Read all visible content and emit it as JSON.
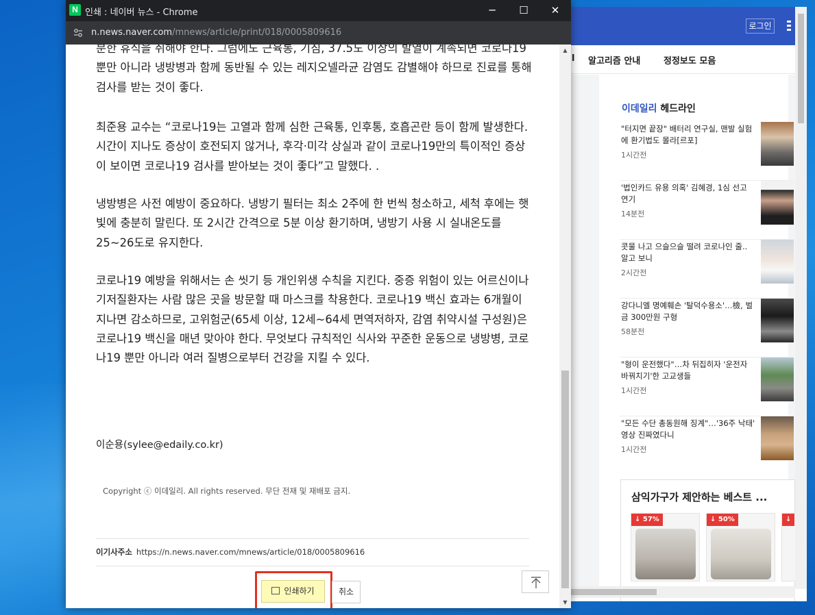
{
  "popup": {
    "app_icon_letter": "N",
    "window_title": "인쇄 : 네이버 뉴스 - Chrome",
    "url_domain": "n.news.naver.com",
    "url_path": "/mnews/article/print/018/0005809616",
    "controls": {
      "minimize": "─",
      "maximize": "☐",
      "close": "✕"
    }
  },
  "article": {
    "paragraphs": [
      "분한 휴식을 취해야 한다. 그럼에도 근육통, 기침, 37.5도 이상의 발열이 계속되면 코로나19 뿐만 아니라 냉방병과 함께 동반될 수 있는 레지오넬라균 감염도 감별해야 하므로 진료를 통해 검사를 받는 것이 좋다.",
      "최준용 교수는 “코로나19는 고열과 함께 심한 근육통, 인후통, 호흡곤란 등이 함께 발생한다. 시간이 지나도 증상이 호전되지 않거나, 후각·미각 상실과 같이 코로나19만의 특이적인 증상이 보이면 코로나19 검사를 받아보는 것이 좋다”고 말했다. .",
      "냉방병은 사전 예방이 중요하다. 냉방기 필터는 최소 2주에 한 번씩 청소하고, 세척 후에는 햇빛에 충분히 말린다. 또 2시간 간격으로 5분 이상 환기하며, 냉방기 사용 시 실내온도를 25~26도로 유지한다.",
      "코로나19 예방을 위해서는 손 씻기 등 개인위생 수칙을 지킨다. 중증 위험이 있는 어르신이나 기저질환자는 사람 많은 곳을 방문할 때 마스크를 착용한다. 코로나19 백신 효과는 6개월이 지나면 감소하므로, 고위험군(65세 이상, 12세~64세 면역저하자, 감염 취약시설 구성원)은 코로나19 백신을 매년 맞아야 한다. 무엇보다 규칙적인 식사와 꾸준한 운동으로 냉방병, 코로나19 뿐만 아니라 여러 질병으로부터 건강을 지킬 수 있다."
    ],
    "byline": "이순용(sylee@edaily.co.kr)",
    "copyright": "Copyright ⓒ 이데일리. All rights reserved. 무단 전재 및 재배포 금지.",
    "url_label": "이기사주소",
    "url_value": "https://n.news.naver.com/mnews/article/018/0005809616"
  },
  "actions": {
    "print_label": "인쇄하기",
    "cancel_label": "취소",
    "top_icon": "arrow-up-icon"
  },
  "background_page": {
    "login_label": "로그인",
    "nav_partial": "l",
    "nav_items": [
      "알고리즘 안내",
      "정정보도 모음"
    ],
    "headline_brand": "이데일리",
    "headline_suffix": " 헤드라인",
    "headlines": [
      {
        "title": "\"터지면 끝장\" 배터리 연구실, 맨발 실험에 환기법도 몰라[르포]",
        "time": "1시간전"
      },
      {
        "title": "'법인카드 유용 의혹' 김혜경, 1심 선고 연기",
        "time": "14분전"
      },
      {
        "title": "콧물 나고 으슬으슬 떨려 코로나인 줄.. 알고 보니",
        "time": "2시간전"
      },
      {
        "title": "강다니엘 명예훼손 '탈덕수용소'…檢, 벌금 300만원 구형",
        "time": "58분전"
      },
      {
        "title": "\"형이 운전했다\"…차 뒤집히자 '운전자 바꿔치기'한 고교생들",
        "time": "1시간전"
      },
      {
        "title": "\"모든 수단 총동원해 징계\"…'36주 낙태' 영상 진짜였다니",
        "time": "1시간전"
      }
    ],
    "ad_title": "삼익가구가 제안하는 베스트 ...",
    "ad_badges": [
      "↓ 57%",
      "↓ 50%",
      "↓"
    ]
  },
  "colors": {
    "naver_green": "#03c75a",
    "highlight_red": "#e0311d",
    "print_btn_bg": "#fefbb8",
    "naver_blue": "#2f56c0"
  }
}
